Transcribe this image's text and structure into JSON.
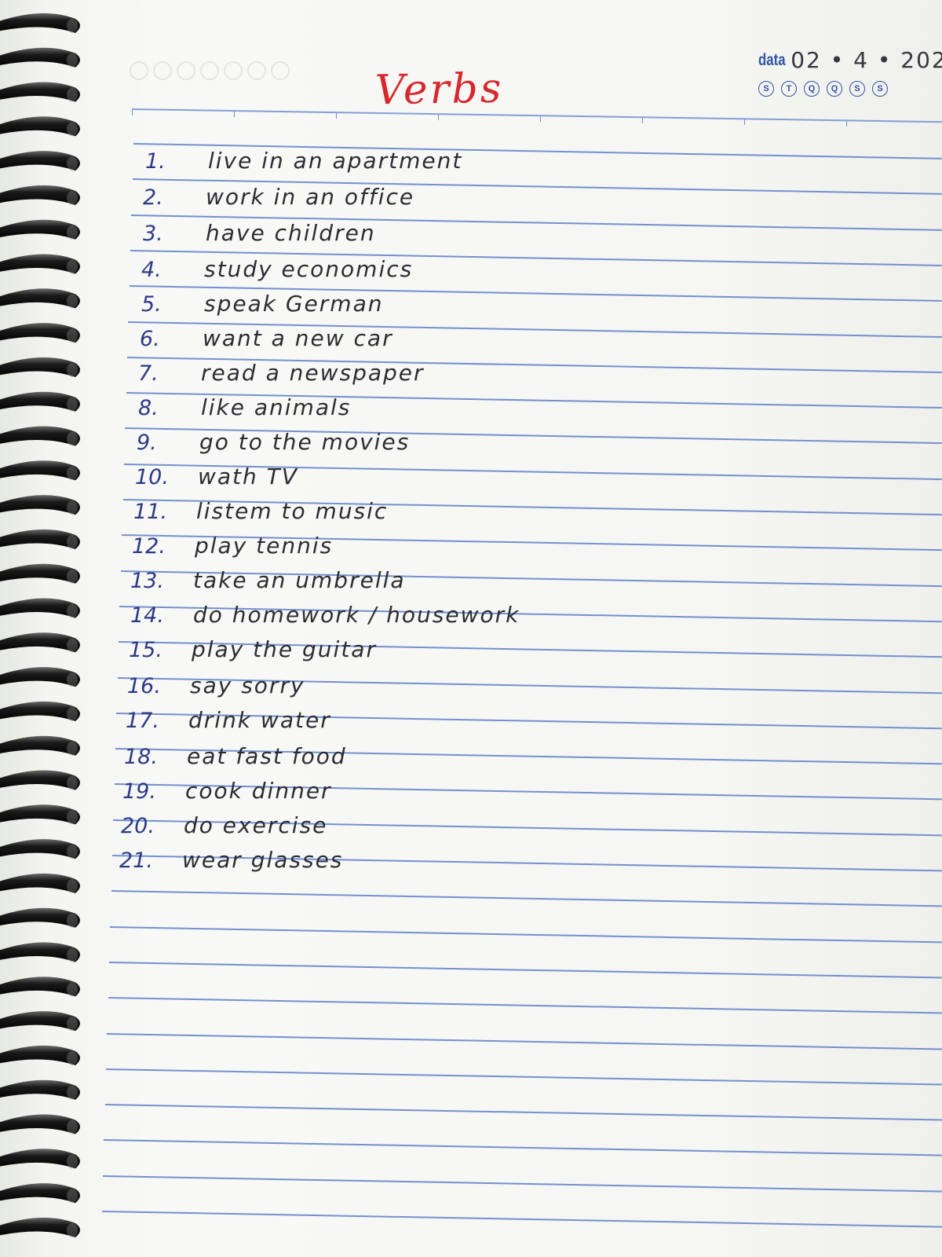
{
  "title": "Verbs",
  "header": {
    "date_label": "data",
    "date_value": "02 • 4 • 202",
    "day_letters": [
      "S",
      "T",
      "Q",
      "Q",
      "S",
      "S"
    ]
  },
  "verbs": [
    {
      "num": "1.",
      "text": "live in an apartment"
    },
    {
      "num": "2.",
      "text": "work in an office"
    },
    {
      "num": "3.",
      "text": "have children"
    },
    {
      "num": "4.",
      "text": "study economics"
    },
    {
      "num": "5.",
      "text": "speak German"
    },
    {
      "num": "6.",
      "text": "want a new car"
    },
    {
      "num": "7.",
      "text": "read a newspaper"
    },
    {
      "num": "8.",
      "text": "like animals"
    },
    {
      "num": "9.",
      "text": "go to the movies"
    },
    {
      "num": "10.",
      "text": "wath TV"
    },
    {
      "num": "11.",
      "text": "listem to music"
    },
    {
      "num": "12.",
      "text": "play tennis"
    },
    {
      "num": "13.",
      "text": "take an umbrella"
    },
    {
      "num": "14.",
      "text": "do homework / housework"
    },
    {
      "num": "15.",
      "text": "play the guitar"
    },
    {
      "num": "16.",
      "text": "say sorry"
    },
    {
      "num": "17.",
      "text": "drink water"
    },
    {
      "num": "18.",
      "text": "eat fast food"
    },
    {
      "num": "19.",
      "text": "cook dinner"
    },
    {
      "num": "20.",
      "text": "do exercise"
    },
    {
      "num": "21.",
      "text": "wear glasses"
    }
  ],
  "colors": {
    "title": "#d8282f",
    "numbers": "#2c3a86",
    "handwriting": "#2b2d33",
    "ruled_lines": "#5b7fc9",
    "printed_header": "#2f55a8"
  }
}
